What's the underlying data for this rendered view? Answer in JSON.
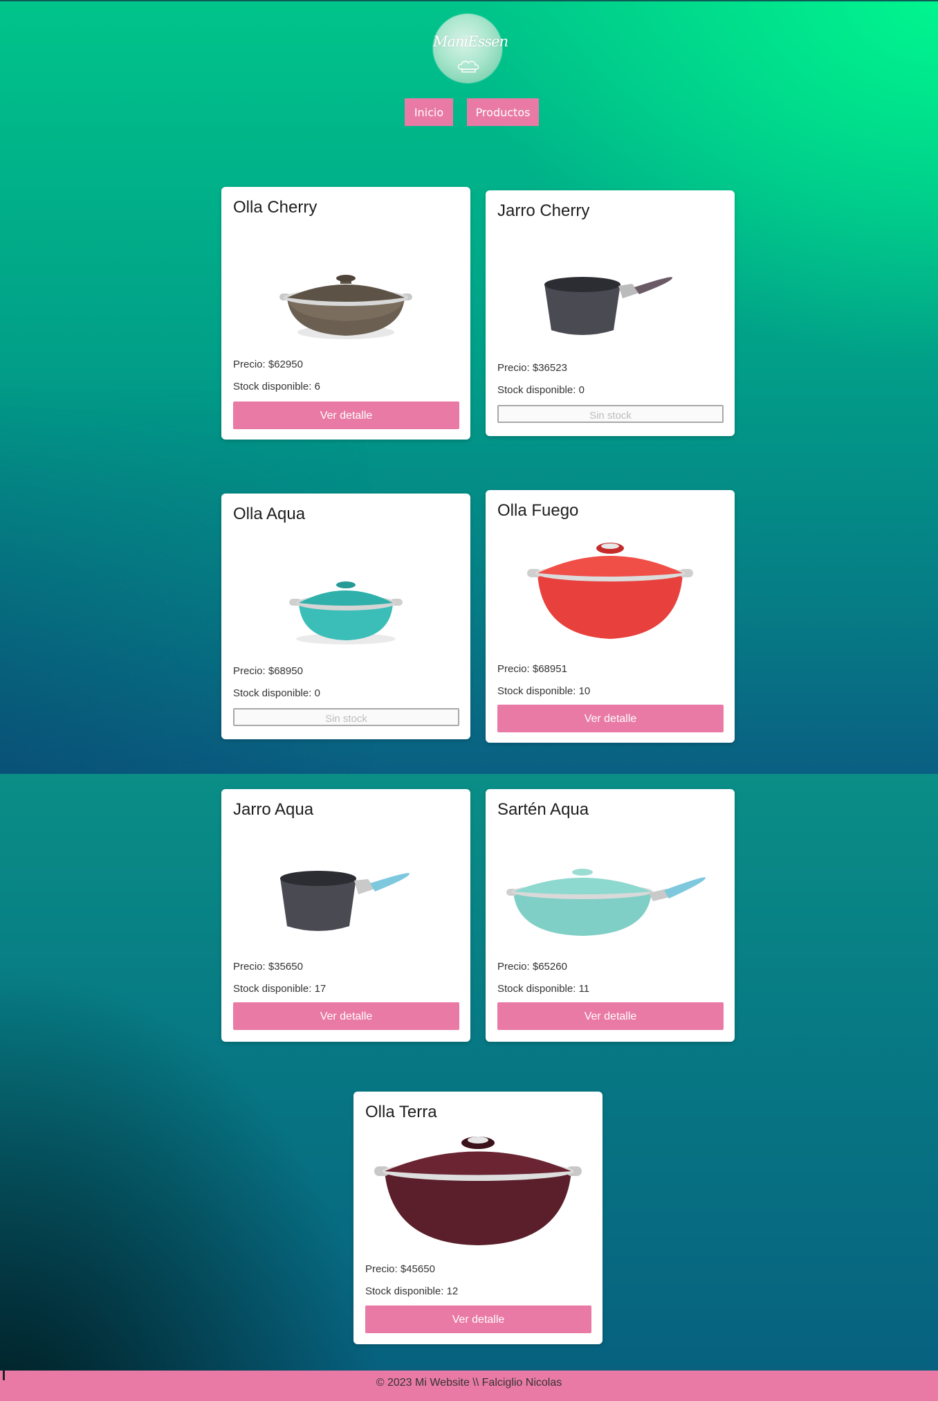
{
  "header": {
    "logo_text": "ManiEssen",
    "nav": [
      {
        "label": "Inicio"
      },
      {
        "label": "Productos"
      }
    ]
  },
  "products": [
    {
      "name": "Olla Cherry",
      "price": "Precio: $62950",
      "stock": "Stock disponible: 6",
      "action": "Ver detalle",
      "color": "#6f6355"
    },
    {
      "name": "Jarro Cherry",
      "price": "Precio: $36523",
      "stock": "Stock disponible: 0",
      "action": "Sin stock",
      "color": "#4a4a52"
    },
    {
      "name": "Olla Aqua",
      "price": "Precio: $68950",
      "stock": "Stock disponible: 0",
      "action": "Sin stock",
      "color": "#3bbdb8"
    },
    {
      "name": "Olla Fuego",
      "price": "Precio: $68951",
      "stock": "Stock disponible: 10",
      "action": "Ver detalle",
      "color": "#e8403c"
    },
    {
      "name": "Jarro Aqua",
      "price": "Precio: $35650",
      "stock": "Stock disponible: 17",
      "action": "Ver detalle",
      "color": "#4a4a52"
    },
    {
      "name": "Sartén Aqua",
      "price": "Precio: $65260",
      "stock": "Stock disponible: 11",
      "action": "Ver detalle",
      "color": "#7fcfc6"
    },
    {
      "name": "Olla Terra",
      "price": "Precio: $45650",
      "stock": "Stock disponible: 12",
      "action": "Ver detalle",
      "color": "#5a1f2a"
    }
  ],
  "footer": {
    "text": "© 2023 Mi Website \\\\ Falciglio Nicolas"
  },
  "colors": {
    "accent": "#e97aa5",
    "bg_green": "#00f58e",
    "bg_teal": "#07617f"
  }
}
